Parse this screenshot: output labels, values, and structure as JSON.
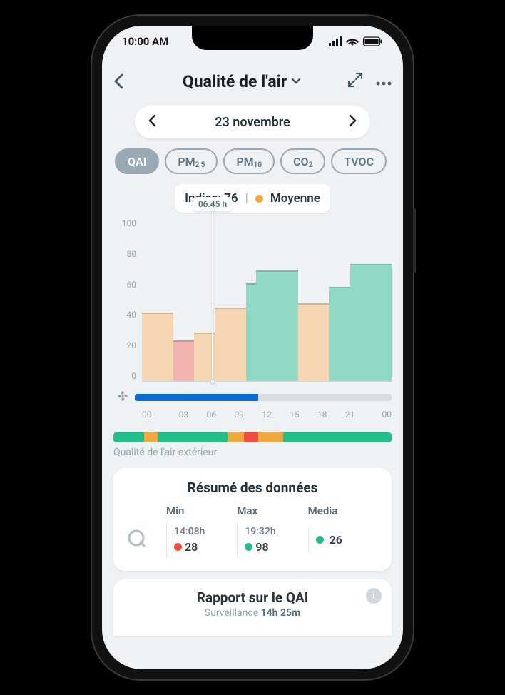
{
  "status": {
    "time": "10:00 AM"
  },
  "header": {
    "title": "Qualité de l'air"
  },
  "date_nav": {
    "label": "23 novembre"
  },
  "chips": [
    {
      "label": "QAI",
      "sub": "",
      "active": true
    },
    {
      "label": "PM",
      "sub": "2,5",
      "active": false
    },
    {
      "label": "PM",
      "sub": "10",
      "active": false
    },
    {
      "label": "CO",
      "sub": "2",
      "active": false
    },
    {
      "label": "TVOC",
      "sub": "",
      "active": false
    }
  ],
  "indice": {
    "prefix": "Indice:",
    "value": "76",
    "status_label": "Moyenne",
    "status_color": "#f2a93b"
  },
  "chart_data": {
    "type": "area",
    "ylabel": "",
    "ylim": [
      0,
      100
    ],
    "y_ticks": [
      "100",
      "80",
      "60",
      "40",
      "20",
      "0"
    ],
    "x_ticks": [
      "00",
      "03",
      "06",
      "09",
      "12",
      "15",
      "18",
      "21",
      "00"
    ],
    "cursor": {
      "label": "06:45 h",
      "x_pct": 28
    },
    "series": [
      {
        "name": "QAI",
        "points": [
          {
            "h": 0,
            "v": 42,
            "band": "moderate"
          },
          {
            "h": 1,
            "v": 42,
            "band": "moderate"
          },
          {
            "h": 2,
            "v": 42,
            "band": "moderate"
          },
          {
            "h": 3,
            "v": 25,
            "band": "bad"
          },
          {
            "h": 4,
            "v": 25,
            "band": "bad"
          },
          {
            "h": 5,
            "v": 30,
            "band": "moderate"
          },
          {
            "h": 6,
            "v": 30,
            "band": "moderate"
          },
          {
            "h": 7,
            "v": 45,
            "band": "moderate"
          },
          {
            "h": 8,
            "v": 45,
            "band": "moderate"
          },
          {
            "h": 9,
            "v": 45,
            "band": "moderate"
          },
          {
            "h": 10,
            "v": 60,
            "band": "good"
          },
          {
            "h": 11,
            "v": 68,
            "band": "good"
          },
          {
            "h": 12,
            "v": 68,
            "band": "good"
          },
          {
            "h": 13,
            "v": 68,
            "band": "good"
          },
          {
            "h": 14,
            "v": 68,
            "band": "good"
          },
          {
            "h": 15,
            "v": 48,
            "band": "moderate"
          },
          {
            "h": 16,
            "v": 48,
            "band": "moderate"
          },
          {
            "h": 17,
            "v": 48,
            "band": "moderate"
          },
          {
            "h": 18,
            "v": 58,
            "band": "good"
          },
          {
            "h": 19,
            "v": 58,
            "band": "good"
          },
          {
            "h": 20,
            "v": 72,
            "band": "good"
          },
          {
            "h": 21,
            "v": 72,
            "band": "good"
          },
          {
            "h": 22,
            "v": 72,
            "band": "good"
          },
          {
            "h": 23,
            "v": 72,
            "band": "good"
          }
        ]
      }
    ],
    "band_colors": {
      "good": "#8fd9c6",
      "moderate": "#f6d6b3",
      "bad": "#f3b3b0"
    },
    "fan_on_fraction": 0.48
  },
  "outdoor": {
    "label": "Qualité de l'air extérieur",
    "segments": [
      {
        "w": 11,
        "c": "#1fbf88"
      },
      {
        "w": 5,
        "c": "#f2a93b"
      },
      {
        "w": 25,
        "c": "#1fbf88"
      },
      {
        "w": 6,
        "c": "#f2a93b"
      },
      {
        "w": 5,
        "c": "#ef4f3e"
      },
      {
        "w": 9,
        "c": "#f2a93b"
      },
      {
        "w": 39,
        "c": "#1fbf88"
      }
    ]
  },
  "summary": {
    "title": "Résumé des données",
    "cols": {
      "min": "Min",
      "max": "Max",
      "media": "Media"
    },
    "min": {
      "time": "14:08h",
      "value": "28",
      "color": "#ef4f3e"
    },
    "max": {
      "time": "19:32h",
      "value": "98",
      "color": "#1fbf88"
    },
    "media": {
      "value": "26",
      "color": "#1fbf88"
    }
  },
  "report": {
    "title": "Rapport sur le QAI",
    "sub_label": "Surveillance",
    "duration": "14h 25m"
  }
}
